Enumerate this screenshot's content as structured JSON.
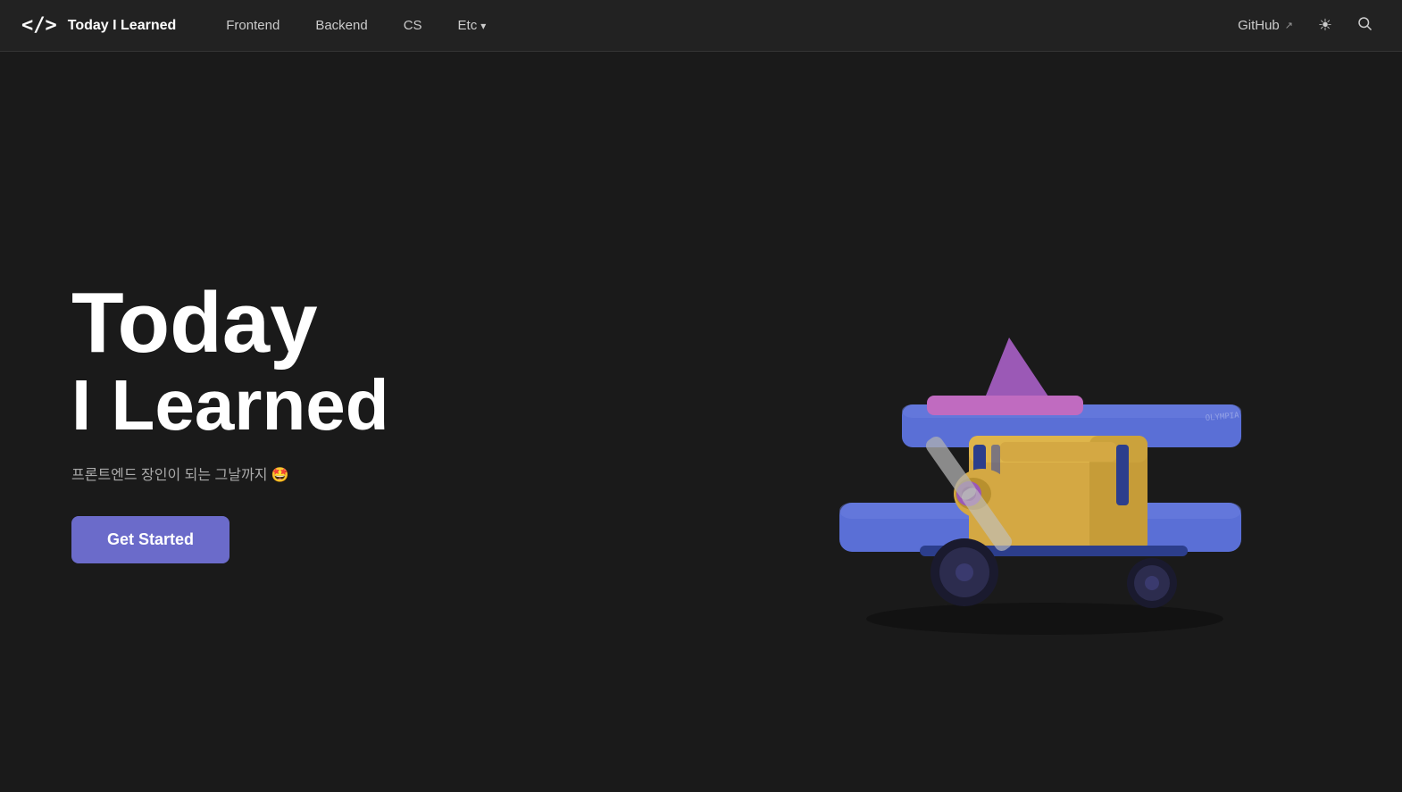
{
  "nav": {
    "logo_icon": "</>",
    "logo_title": "Today I Learned",
    "links": [
      {
        "label": "Frontend",
        "has_dropdown": false
      },
      {
        "label": "Backend",
        "has_dropdown": false
      },
      {
        "label": "CS",
        "has_dropdown": false
      },
      {
        "label": "Etc",
        "has_dropdown": true
      }
    ],
    "github_label": "GitHub",
    "theme_icon": "☀",
    "search_icon": "🔍"
  },
  "hero": {
    "title_line1": "Today",
    "title_line2": "I Learned",
    "subtitle": "프론트엔드 장인이 되는 그날까지 🤩",
    "cta_label": "Get Started"
  },
  "colors": {
    "bg": "#1a1a1a",
    "nav_bg": "#222",
    "accent": "#6b6bca",
    "plane_blue": "#5a6fd6",
    "plane_purple": "#9b59b6",
    "plane_gold": "#d4a843",
    "plane_dark_blue": "#2c3e8c"
  }
}
